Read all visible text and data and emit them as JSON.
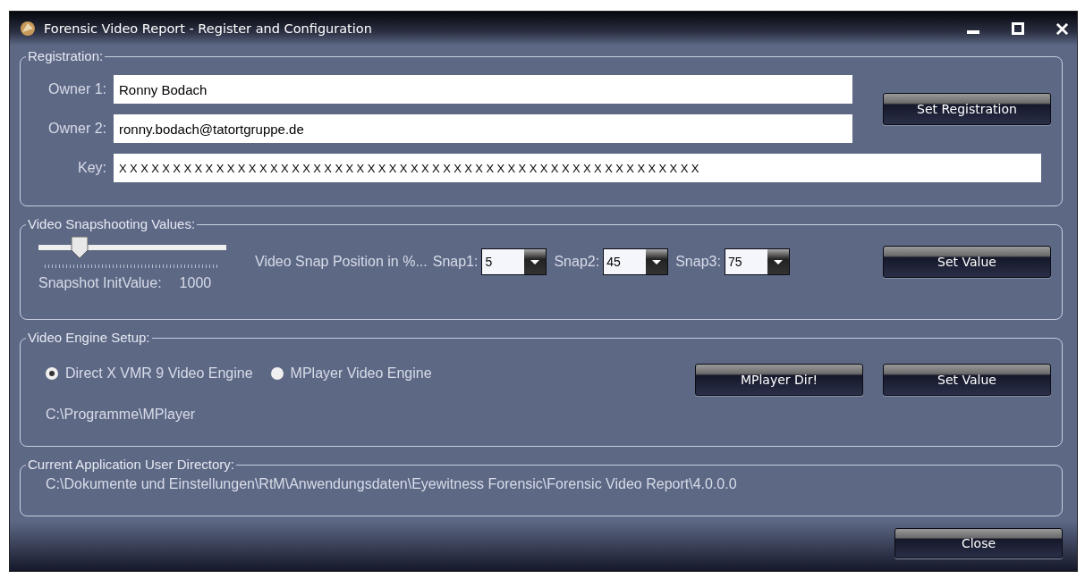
{
  "window": {
    "title": "Forensic Video Report - Register and Configuration"
  },
  "registration": {
    "legend": "Registration:",
    "fields": [
      {
        "label": "Owner 1:",
        "value": "Ronny Bodach"
      },
      {
        "label": "Owner 2:",
        "value": "ronny.bodach@tatortgruppe.de"
      },
      {
        "label": "Key:",
        "value": "XXXXXXXXXXXXXXXXXXXXXXXXXXXXXXXXXXXXXXXXXXXXXXXXXXXXXX"
      }
    ],
    "button": "Set Registration"
  },
  "snapshot": {
    "legend": "Video Snapshooting Values:",
    "slider": {
      "level": 0.22
    },
    "init_label": "Snapshot InitValue:",
    "init_value": "1000",
    "position_label": "Video Snap Position in %...",
    "snaps": [
      {
        "label": "Snap1:",
        "value": "5"
      },
      {
        "label": "Snap2:",
        "value": "45"
      },
      {
        "label": "Snap3:",
        "value": "75"
      }
    ],
    "button": "Set Value"
  },
  "engine": {
    "legend": "Video Engine Setup:",
    "options": [
      {
        "label": "Direct X VMR 9 Video Engine",
        "selected": true
      },
      {
        "label": "MPlayer Video Engine",
        "selected": false
      }
    ],
    "path": "C:\\Programme\\MPlayer",
    "buttons": [
      "MPlayer Dir!",
      "Set Value"
    ]
  },
  "user_directory": {
    "legend": "Current Application User Directory:",
    "path": "C:\\Dokumente und Einstellungen\\RtM\\Anwendungsdaten\\Eyewitness Forensic\\Forensic Video Report\\4.0.0.0"
  },
  "footer": {
    "button": "Close"
  }
}
